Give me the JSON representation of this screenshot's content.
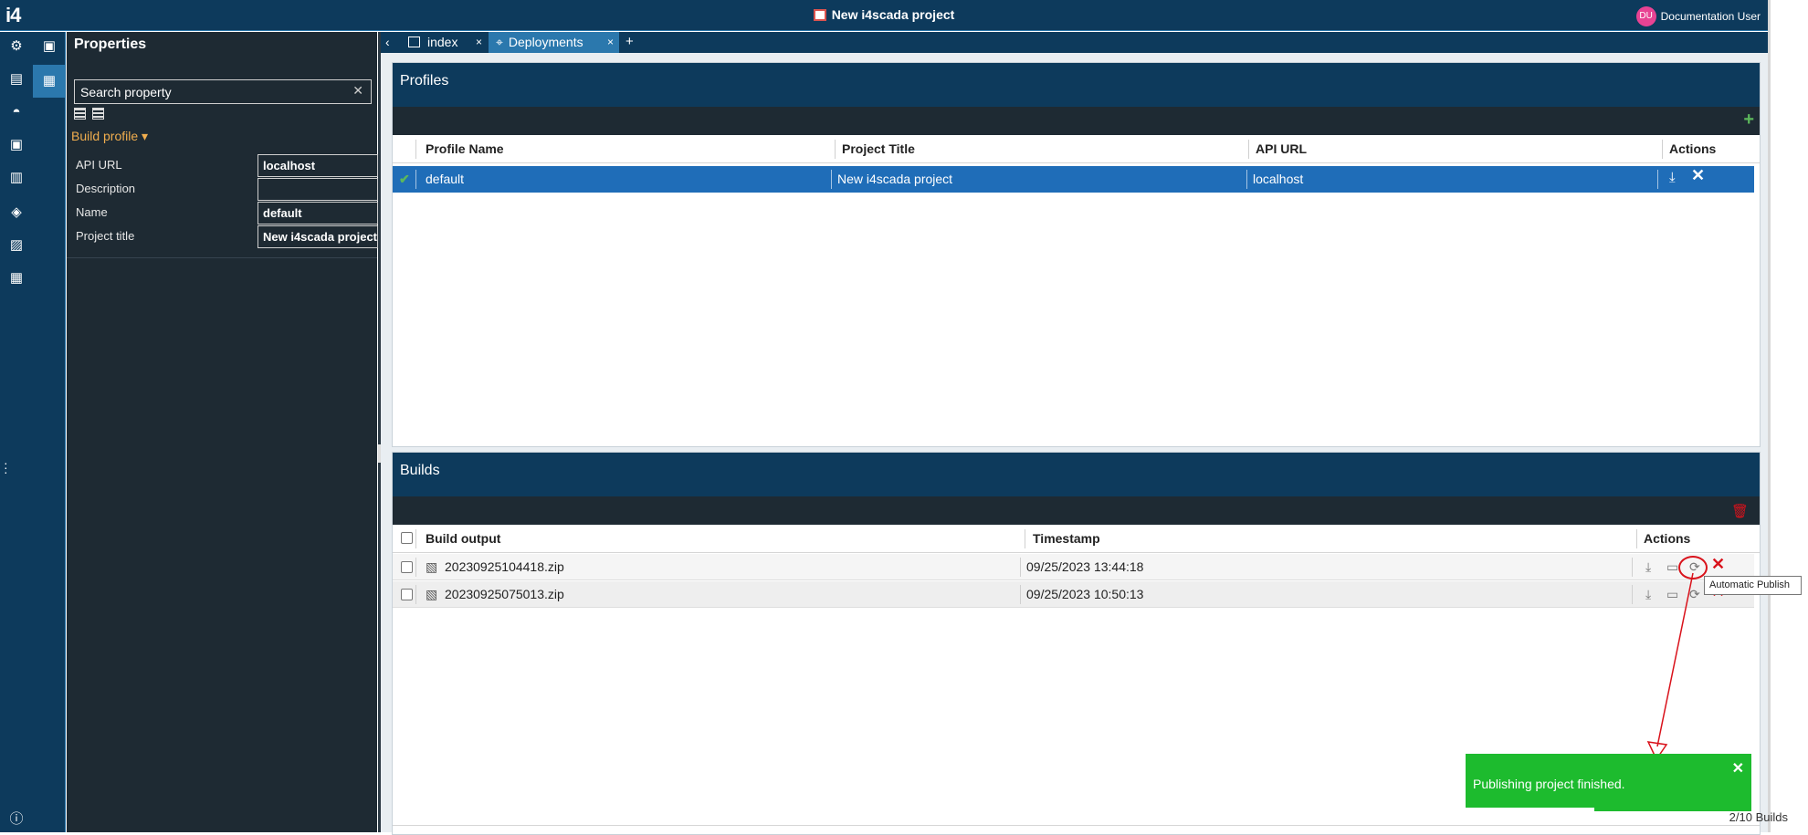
{
  "app": {
    "logo": "i4",
    "title": "New i4scada project",
    "user_initials": "DU",
    "user_name": "Documentation User"
  },
  "properties": {
    "title": "Properties",
    "search_placeholder": "Search property",
    "section": "Build profile ▾",
    "rows": [
      {
        "label": "API URL",
        "value": "localhost"
      },
      {
        "label": "Description",
        "value": ""
      },
      {
        "label": "Name",
        "value": "default"
      },
      {
        "label": "Project title",
        "value": "New i4scada project"
      }
    ]
  },
  "tabs": [
    {
      "label": "index",
      "close": "×"
    },
    {
      "label": "Deployments",
      "close": "×"
    }
  ],
  "tab_add": "+",
  "tab_back": "‹",
  "profiles": {
    "title": "Profiles",
    "add": "+",
    "columns": [
      "Profile Name",
      "Project Title",
      "API URL",
      "Actions"
    ],
    "rows": [
      {
        "check": "✔",
        "name": "default",
        "project_title": "New i4scada project",
        "api_url": "localhost"
      }
    ]
  },
  "builds": {
    "title": "Builds",
    "columns": [
      "Build output",
      "Timestamp",
      "Actions"
    ],
    "rows": [
      {
        "file": "20230925104418.zip",
        "timestamp": "09/25/2023 13:44:18"
      },
      {
        "file": "20230925075013.zip",
        "timestamp": "09/25/2023 10:50:13"
      }
    ],
    "count": "2/10 Builds"
  },
  "tooltip": "Automatic Publish",
  "toast": {
    "message": "Publishing project finished.",
    "close": "✕",
    "progress": 0.45
  },
  "colors": {
    "topbar": "#0d3a5c",
    "accent": "#2b78ad",
    "selected_row": "#1f6db8",
    "toast": "#1dbb2e",
    "danger": "#d9121b"
  }
}
